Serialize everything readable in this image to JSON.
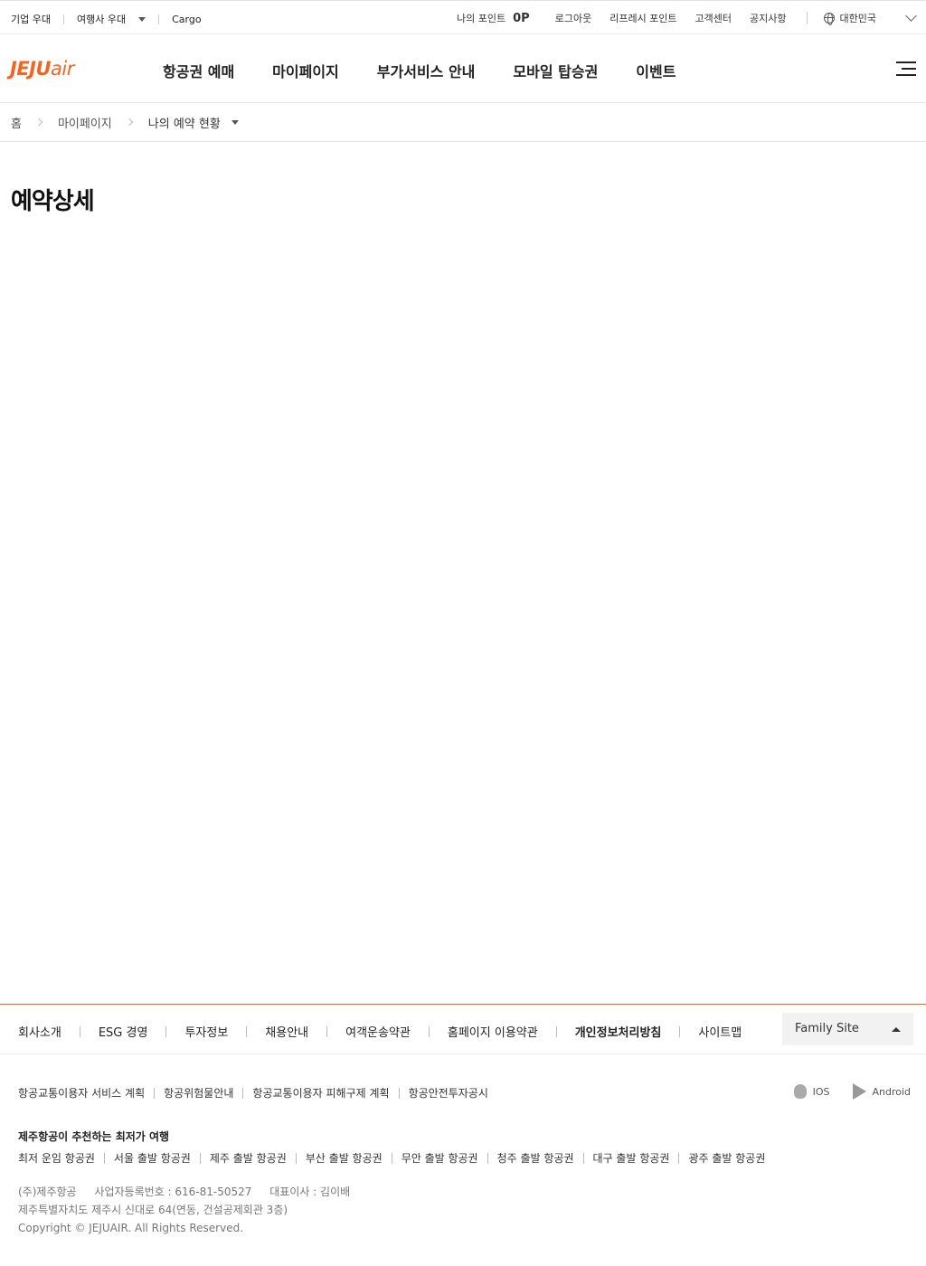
{
  "util": {
    "left_links": [
      "기업 우대",
      "여행사 우대",
      "Cargo"
    ],
    "points_label": "나의 포인트",
    "points_value": "0P",
    "right_links": [
      "로그아웃",
      "리프레시 포인트",
      "고객센터",
      "공지사항"
    ],
    "country": "대한민국"
  },
  "gnb": {
    "logo_main": "JEJU",
    "logo_sub": "air",
    "menu": [
      "항공권 예매",
      "마이페이지",
      "부가서비스 안내",
      "모바일 탑승권",
      "이벤트"
    ]
  },
  "breadcrumb": [
    "홈",
    "마이페이지",
    "나의 예약 현황"
  ],
  "page_title": "예약상세",
  "footer": {
    "links": [
      "회사소개",
      "ESG 경영",
      "투자정보",
      "채용안내",
      "여객운송약관",
      "홈페이지 이용약관",
      "개인정보처리방침",
      "사이트맵"
    ],
    "family_site": "Family Site",
    "sub_links": [
      "항공교통이용자 서비스 계획",
      "항공위험물안내",
      "항공교통이용자 피해구제 계획",
      "항공안전투자공시"
    ],
    "app_ios": "IOS",
    "app_android": "Android",
    "reco_title": "제주항공이 추천하는 최저가 여행",
    "reco_links": [
      "최저 운임 항공권",
      "서울 출발 항공권",
      "제주 출발 항공권",
      "부산 출발 항공권",
      "무안 출발 항공권",
      "청주 출발 항공권",
      "대구 출발 항공권",
      "광주 출발 항공권"
    ],
    "company_name": "(주)제주항공",
    "biz_no": "사업자등록번호 : 616-81-50527",
    "ceo": "대표이사 : 김이배",
    "address": "제주특별자치도 제주시 신대로 64(연동, 건설공제회관 3층)",
    "copyright": "Copyright © JEJUAIR. All Rights Reserved."
  },
  "colors": {
    "brand": "#f26522"
  }
}
